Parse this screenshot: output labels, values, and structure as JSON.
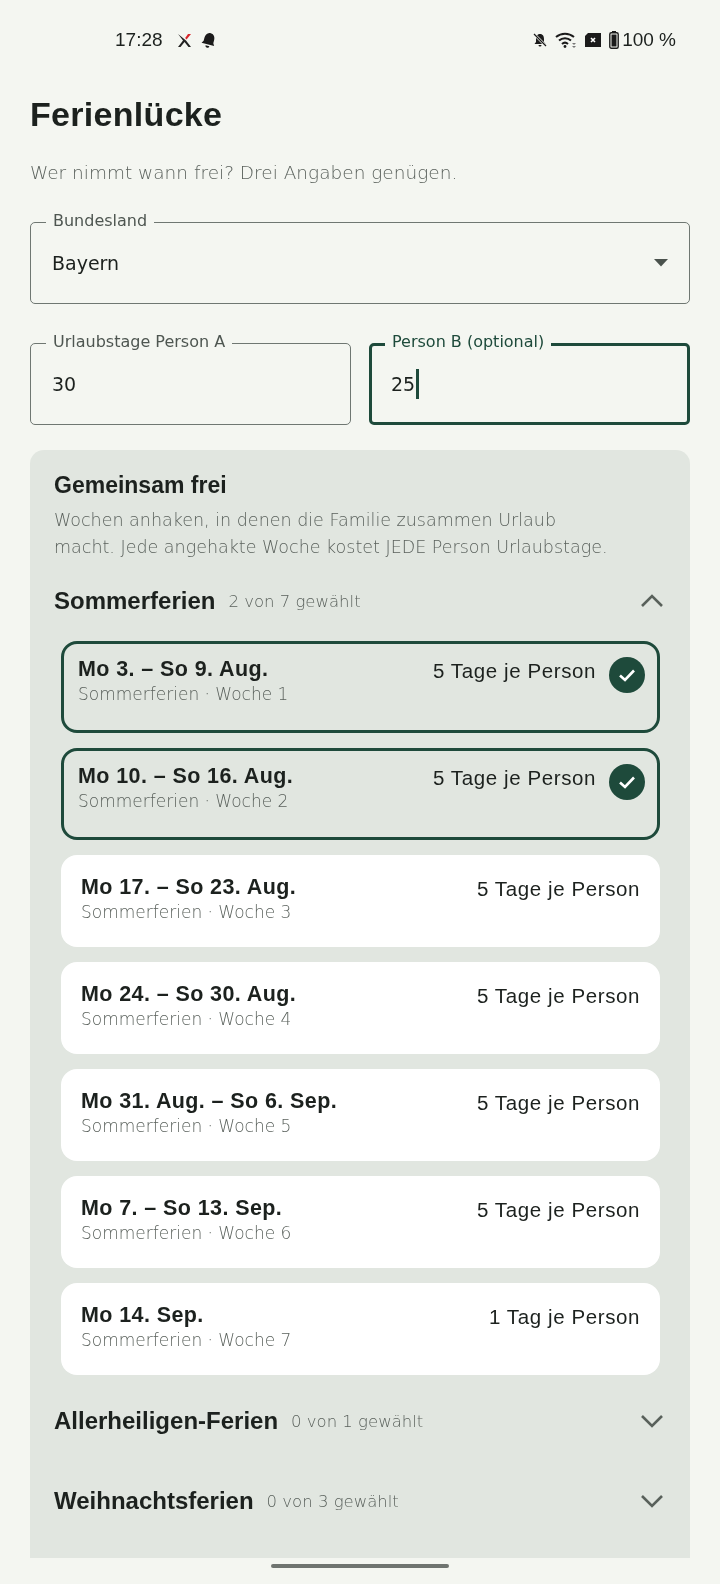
{
  "status_bar": {
    "time": "17:28",
    "battery": "100 %"
  },
  "title": "Ferienlücke",
  "subtitle": "Wer nimmt wann frei? Drei Angaben genügen.",
  "state_field": {
    "label": "Bundesland",
    "value": "Bayern"
  },
  "day_fields": [
    {
      "label": "Urlaubstage Person A",
      "value": "30",
      "focused": false
    },
    {
      "label": "Person B (optional)",
      "value": "25",
      "focused": true
    }
  ],
  "panel": {
    "title": "Gemeinsam frei",
    "description": "Wochen anhaken, in denen die Familie zusammen Urlaub macht. Jede angehakte Woche kostet JEDE Person Urlaubstage.",
    "sections": [
      {
        "name": "Sommerferien",
        "count": "2 von 7 gewählt",
        "expanded": true,
        "weeks": [
          {
            "dates": "Mo 3. – So 9. Aug.",
            "detail": "Sommerferien · Woche 1",
            "cost": "5 Tage je Person",
            "selected": true
          },
          {
            "dates": "Mo 10. – So 16. Aug.",
            "detail": "Sommerferien · Woche 2",
            "cost": "5 Tage je Person",
            "selected": true
          },
          {
            "dates": "Mo 17. – So 23. Aug.",
            "detail": "Sommerferien · Woche 3",
            "cost": "5 Tage je Person",
            "selected": false
          },
          {
            "dates": "Mo 24. – So 30. Aug.",
            "detail": "Sommerferien · Woche 4",
            "cost": "5 Tage je Person",
            "selected": false
          },
          {
            "dates": "Mo 31. Aug. – So 6. Sep.",
            "detail": "Sommerferien · Woche 5",
            "cost": "5 Tage je Person",
            "selected": false
          },
          {
            "dates": "Mo 7. – So 13. Sep.",
            "detail": "Sommerferien · Woche 6",
            "cost": "5 Tage je Person",
            "selected": false
          },
          {
            "dates": "Mo 14. Sep.",
            "detail": "Sommerferien · Woche 7",
            "cost": "1 Tag je Person",
            "selected": false
          }
        ]
      },
      {
        "name": "Allerheiligen-Ferien",
        "count": "0 von 1 gewählt",
        "expanded": false
      },
      {
        "name": "Weihnachtsferien",
        "count": "0 von 3 gewählt",
        "expanded": false
      }
    ]
  }
}
